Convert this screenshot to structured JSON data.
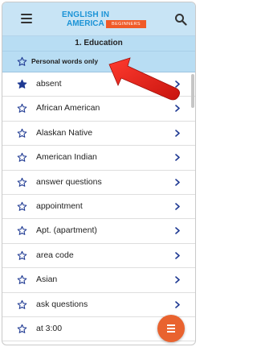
{
  "colors": {
    "header_bg": "#c8e4f5",
    "subheader_bg": "#b8ddf3",
    "logo_blue": "#1b93d6",
    "logo_orange": "#f05a28",
    "fab": "#e9632f",
    "arrow": "#e3231b"
  },
  "header": {
    "logo_line1": "ENGLISH IN",
    "logo_line2": "AMERICA",
    "logo_badge": "BEGINNERS",
    "menu_icon": "hamburger-icon",
    "search_icon": "search-icon"
  },
  "subheader": {
    "title": "1. Education"
  },
  "filter": {
    "label": "Personal words only",
    "checked": false
  },
  "words": [
    {
      "text": "absent",
      "starred": true
    },
    {
      "text": "African American",
      "starred": false
    },
    {
      "text": "Alaskan Native",
      "starred": false
    },
    {
      "text": "American Indian",
      "starred": false
    },
    {
      "text": "answer questions",
      "starred": false
    },
    {
      "text": "appointment",
      "starred": false
    },
    {
      "text": "Apt. (apartment)",
      "starred": false
    },
    {
      "text": "area code",
      "starred": false
    },
    {
      "text": "Asian",
      "starred": false
    },
    {
      "text": "ask questions",
      "starred": false
    },
    {
      "text": "at 3:00",
      "starred": false
    }
  ],
  "fab": {
    "icon": "menu-icon"
  }
}
